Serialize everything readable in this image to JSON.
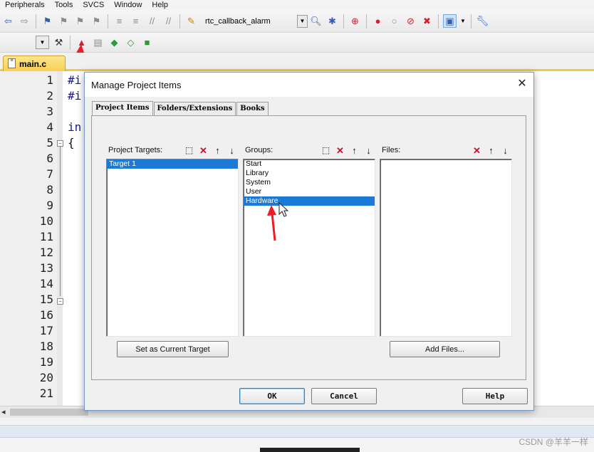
{
  "menu": [
    "Peripherals",
    "Tools",
    "SVCS",
    "Window",
    "Help"
  ],
  "toolbar": {
    "target_name": "rtc_callback_alarm"
  },
  "file_tab": {
    "name": "main.c"
  },
  "editor": {
    "line_numbers": [
      "1",
      "2",
      "3",
      "4",
      "5",
      "6",
      "7",
      "8",
      "9",
      "10",
      "11",
      "12",
      "13",
      "14",
      "15",
      "16",
      "17",
      "18",
      "19",
      "20",
      "21"
    ],
    "code_lines": [
      "#i",
      "#i",
      "",
      "in",
      "{"
    ]
  },
  "dialog": {
    "title": "Manage Project Items",
    "close_label": "✕",
    "tabs": [
      "Project Items",
      "Folders/Extensions",
      "Books"
    ],
    "targets": {
      "label": "Project Targets:",
      "items": [
        "Target 1"
      ],
      "selected": "Target 1",
      "set_current_label": "Set as Current Target"
    },
    "groups": {
      "label": "Groups:",
      "items": [
        "Start",
        "Library",
        "System",
        "User",
        "Hardware"
      ],
      "selected": "Hardware"
    },
    "files": {
      "label": "Files:",
      "items": [],
      "add_files_label": "Add Files..."
    },
    "ok_label": "OK",
    "cancel_label": "Cancel",
    "help_label": "Help"
  },
  "watermark": "CSDN @羊羊一样",
  "colors": {
    "selection": "#1c7ad6",
    "delete_icon": "#c8102e",
    "tab_active": "#f8cf52",
    "annotation_arrow": "#ee1c25"
  },
  "icons": {
    "back": "arrow-left-icon",
    "forward": "arrow-right-icon",
    "manage_project_items": "manage-project-items-icon",
    "new": "new-item-icon",
    "delete": "delete-x-icon",
    "up": "move-up-icon",
    "down": "move-down-icon"
  }
}
